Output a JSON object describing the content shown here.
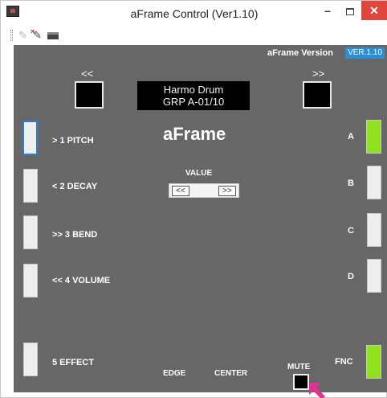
{
  "window": {
    "title": "aFrame Control (Ver1.10)",
    "controls": {
      "minimize": "–",
      "maximize": "",
      "close": "✕"
    }
  },
  "toolbar": {
    "icons": [
      "plug-disconnected-icon",
      "plug-connect-icon",
      "printer-icon"
    ]
  },
  "header": {
    "version_label": "aFrame Version",
    "version_badge": "VER.1.10"
  },
  "nav": {
    "prev_label": "<<",
    "next_label": ">>"
  },
  "display": {
    "line1": "Harmo Drum",
    "line2": "GRP A-01/10"
  },
  "brand": "aFrame",
  "params": [
    {
      "label": "> 1 PITCH",
      "selected": true
    },
    {
      "label": "< 2 DECAY"
    },
    {
      "label": ">> 3 BEND"
    },
    {
      "label": "<< 4 VOLUME"
    },
    {
      "label": "5 EFFECT"
    }
  ],
  "value": {
    "label": "VALUE",
    "dec": "<<",
    "inc": ">>"
  },
  "pads": [
    {
      "label": "A",
      "active": true
    },
    {
      "label": "B",
      "active": false
    },
    {
      "label": "C",
      "active": false
    },
    {
      "label": "D",
      "active": false
    },
    {
      "label": "FNC",
      "active": true
    }
  ],
  "bottom": {
    "edge": "EDGE",
    "center": "CENTER",
    "mute": "MUTE"
  },
  "colors": {
    "panel": "#676767",
    "accent_active": "#92e11e",
    "version_badge": "#2b8fd8",
    "close": "#e0463c",
    "cursor": "#e0338f"
  }
}
